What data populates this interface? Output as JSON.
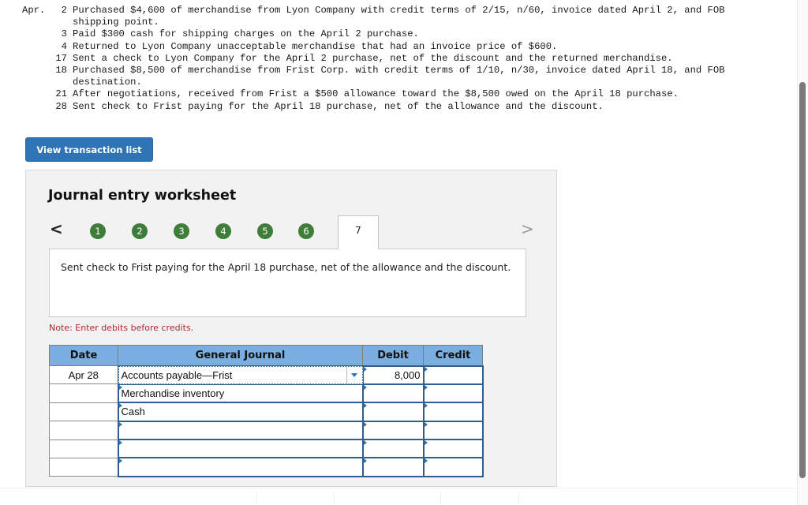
{
  "problem": {
    "month": "Apr.",
    "transactions": [
      {
        "day": "2",
        "text": "Purchased $4,600 of merchandise from Lyon Company with credit terms of 2/15, n/60, invoice dated April 2, and FOB shipping point."
      },
      {
        "day": "3",
        "text": "Paid $300 cash for shipping charges on the April 2 purchase."
      },
      {
        "day": "4",
        "text": "Returned to Lyon Company unacceptable merchandise that had an invoice price of $600."
      },
      {
        "day": "17",
        "text": "Sent a check to Lyon Company for the April 2 purchase, net of the discount and the returned merchandise."
      },
      {
        "day": "18",
        "text": "Purchased $8,500 of merchandise from Frist Corp. with credit terms of 1/10, n/30, invoice dated April 18, and FOB destination."
      },
      {
        "day": "21",
        "text": "After negotiations, received from Frist a $500 allowance toward the $8,500 owed on the April 18 purchase."
      },
      {
        "day": "28",
        "text": "Sent check to Frist paying for the April 18 purchase, net of the allowance and the discount."
      }
    ]
  },
  "view_button_label": "View transaction list",
  "worksheet": {
    "title": "Journal entry worksheet",
    "prev_icon": "<",
    "next_icon": ">",
    "steps": [
      "1",
      "2",
      "3",
      "4",
      "5",
      "6"
    ],
    "active_step": "7",
    "description": "Sent check to Frist paying for the April 18 purchase, net of the allowance and the discount.",
    "note": "Note: Enter debits before credits.",
    "table": {
      "headers": {
        "date": "Date",
        "journal": "General Journal",
        "debit": "Debit",
        "credit": "Credit"
      },
      "rows": [
        {
          "date": "Apr 28",
          "account": "Accounts payable—Frist",
          "debit": "8,000",
          "credit": ""
        },
        {
          "date": "",
          "account": "Merchandise inventory",
          "debit": "",
          "credit": ""
        },
        {
          "date": "",
          "account": "Cash",
          "debit": "",
          "credit": ""
        },
        {
          "date": "",
          "account": "",
          "debit": "",
          "credit": ""
        },
        {
          "date": "",
          "account": "",
          "debit": "",
          "credit": ""
        },
        {
          "date": "",
          "account": "",
          "debit": "",
          "credit": ""
        }
      ]
    }
  },
  "colors": {
    "primary_button": "#2f74b5",
    "step_complete": "#3f7d3b",
    "table_header": "#7aaee0",
    "note_text": "#b3272d"
  }
}
